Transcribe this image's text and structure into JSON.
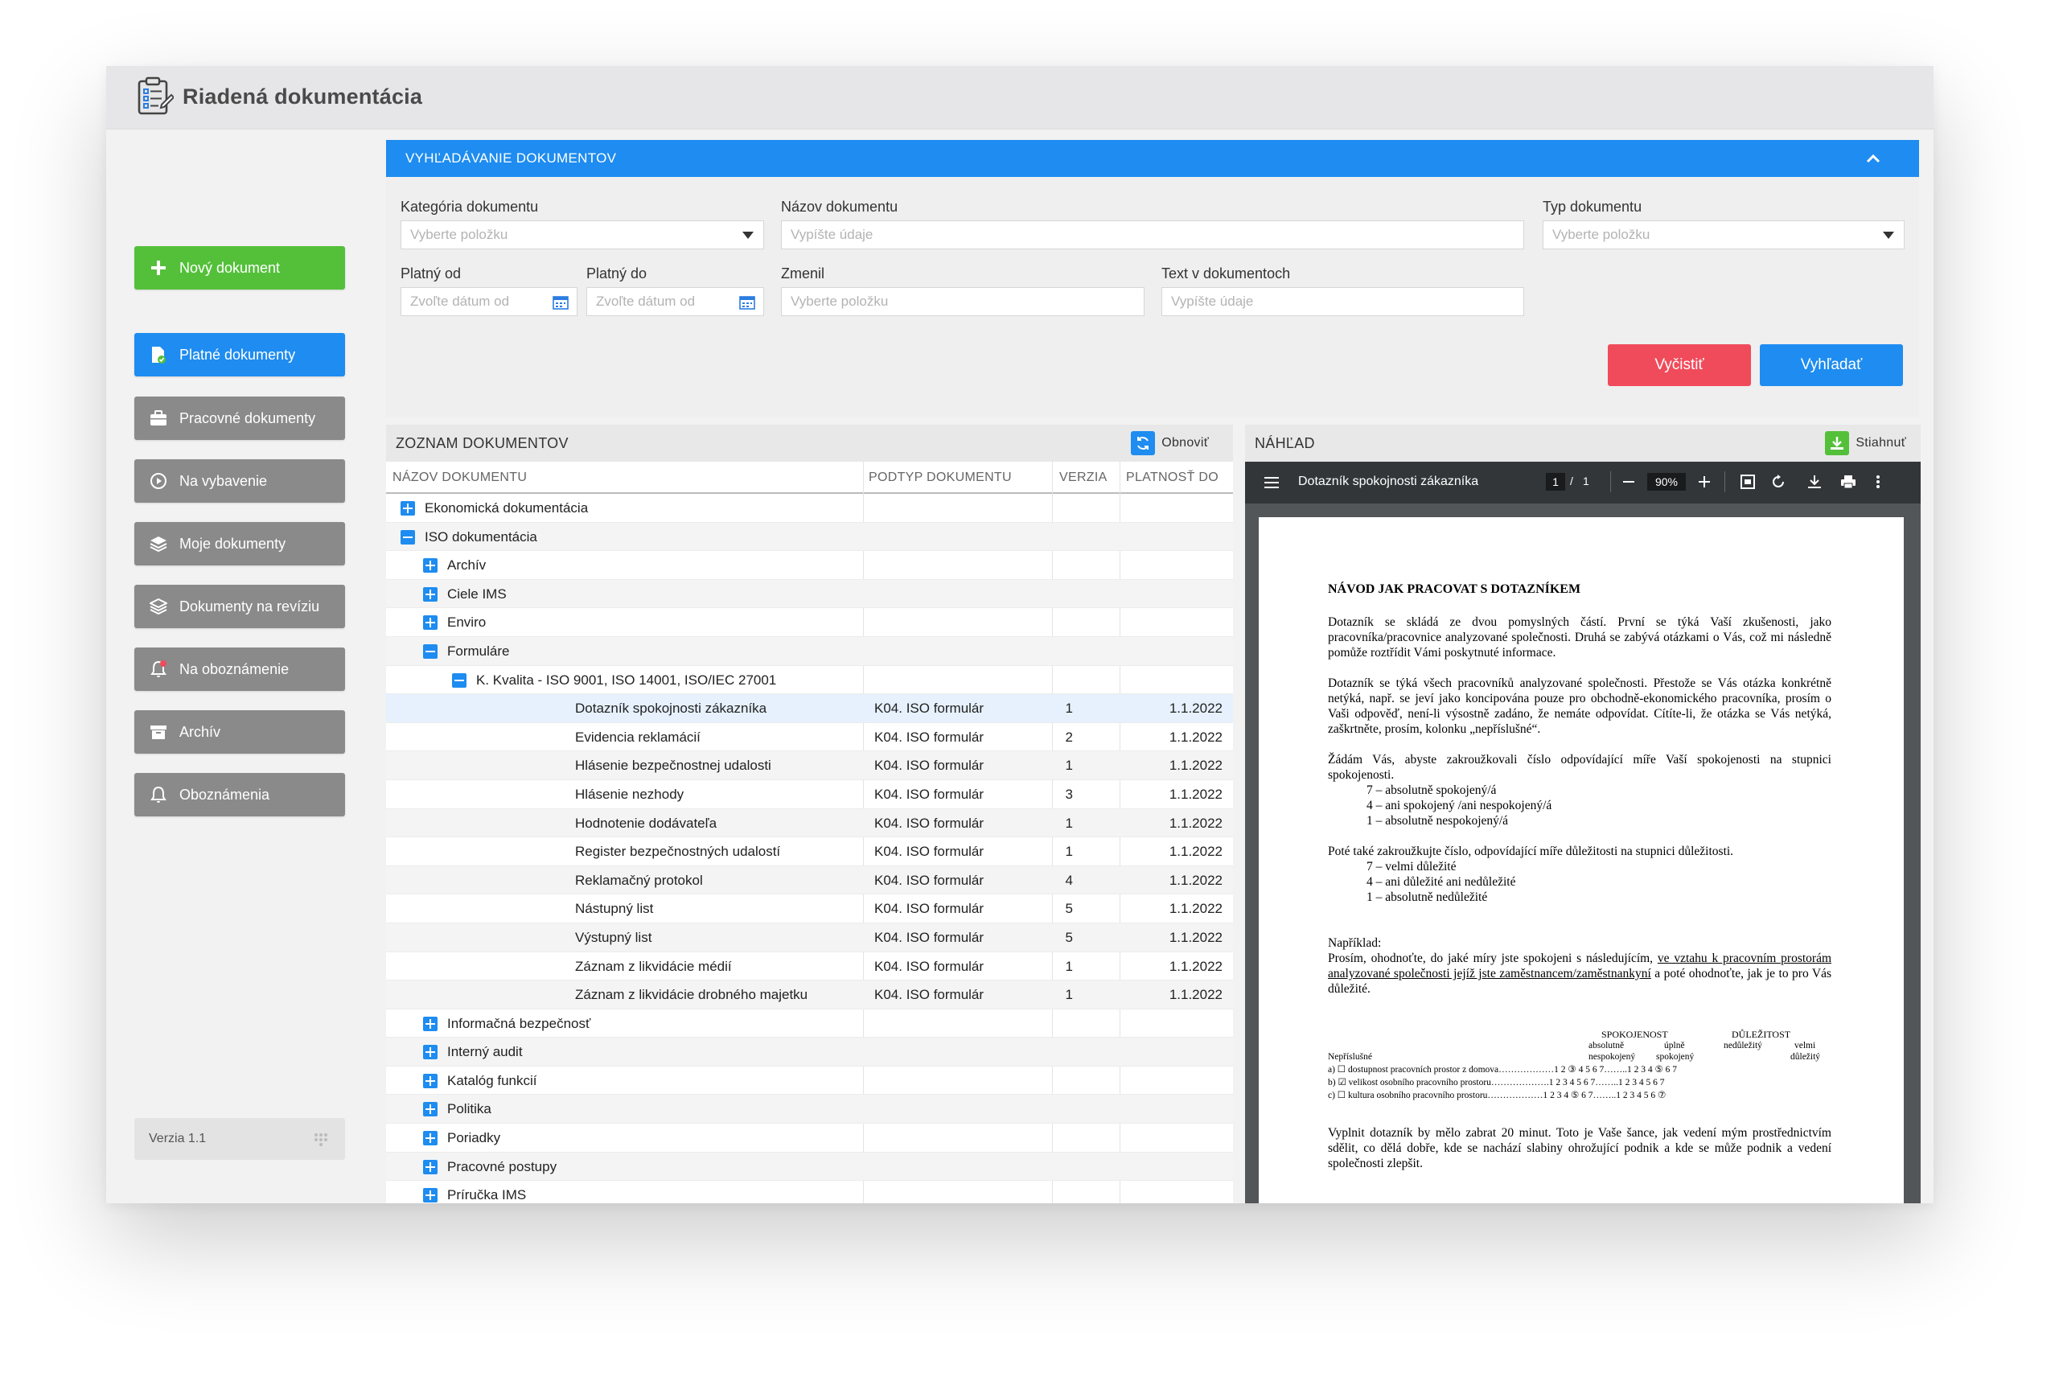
{
  "app": {
    "title": "Riadená dokumentácia"
  },
  "sidebar": {
    "new_document": "Nový dokument",
    "items": [
      {
        "label": "Platné dokumenty",
        "icon": "valid-docs-icon",
        "active": true
      },
      {
        "label": "Pracovné dokumenty",
        "icon": "briefcase-icon",
        "active": false
      },
      {
        "label": "Na vybavenie",
        "icon": "play-circle-icon",
        "active": false
      },
      {
        "label": "Moje dokumenty",
        "icon": "layers-icon",
        "active": false
      },
      {
        "label": "Dokumenty na revíziu",
        "icon": "layers-check-icon",
        "active": false
      },
      {
        "label": "Na oboznámenie",
        "icon": "bell-alert-icon",
        "active": false
      },
      {
        "label": "Archív",
        "icon": "archive-box-icon",
        "active": false
      },
      {
        "label": "Oboznámenia",
        "icon": "bell-icon",
        "active": false
      }
    ],
    "version": "Verzia 1.1"
  },
  "search": {
    "title": "VYHĽADÁVANIE DOKUMENTOV",
    "category": {
      "label": "Kategória dokumentu",
      "placeholder": "Vyberte položku"
    },
    "name": {
      "label": "Názov dokumentu",
      "placeholder": "Vypíšte údaje"
    },
    "type": {
      "label": "Typ dokumentu",
      "placeholder": "Vyberte položku"
    },
    "valid_from": {
      "label": "Platný od",
      "placeholder": "Zvoľte dátum od"
    },
    "valid_to": {
      "label": "Platný do",
      "placeholder": "Zvoľte dátum od"
    },
    "changed_by": {
      "label": "Zmenil",
      "placeholder": "Vyberte položku"
    },
    "fulltext": {
      "label": "Text v dokumentoch",
      "placeholder": "Vypíšte údaje"
    },
    "clear_button": "Vyčistiť",
    "search_button": "Vyhľadať"
  },
  "colors": {
    "accent_blue": "#1e8cf0",
    "green": "#54c03a",
    "red": "#f04b5b",
    "sidebar_gray": "#8a8a8a"
  },
  "list": {
    "title": "ZOZNAM DOKUMENTOV",
    "refresh": "Obnoviť",
    "columns": [
      "NÁZOV DOKUMENTU",
      "PODTYP DOKUMENTU",
      "VERZIA",
      "PLATNOSŤ DO"
    ],
    "rows": [
      {
        "level": 0,
        "toggle": "plus",
        "name": "Ekonomická dokumentácia"
      },
      {
        "level": 0,
        "toggle": "minus",
        "name": "ISO dokumentácia"
      },
      {
        "level": 1,
        "toggle": "plus",
        "name": "Archív"
      },
      {
        "level": 1,
        "toggle": "plus",
        "name": "Ciele IMS"
      },
      {
        "level": 1,
        "toggle": "plus",
        "name": "Enviro"
      },
      {
        "level": 1,
        "toggle": "minus",
        "name": "Formuláre"
      },
      {
        "level": 2,
        "toggle": "minus",
        "name": "K. Kvalita - ISO 9001, ISO 14001, ISO/IEC 27001"
      },
      {
        "level": 3,
        "name": "Dotazník spokojnosti zákazníka",
        "subtype": "K04. ISO formulár",
        "version": "1",
        "valid_to": "1.1.2022",
        "selected": true
      },
      {
        "level": 3,
        "name": "Evidencia reklamácií",
        "subtype": "K04. ISO formulár",
        "version": "2",
        "valid_to": "1.1.2022"
      },
      {
        "level": 3,
        "name": "Hlásenie bezpečnostnej udalosti",
        "subtype": "K04. ISO formulár",
        "version": "1",
        "valid_to": "1.1.2022"
      },
      {
        "level": 3,
        "name": "Hlásenie nezhody",
        "subtype": "K04. ISO formulár",
        "version": "3",
        "valid_to": "1.1.2022"
      },
      {
        "level": 3,
        "name": "Hodnotenie dodávateľa",
        "subtype": "K04. ISO formulár",
        "version": "1",
        "valid_to": "1.1.2022"
      },
      {
        "level": 3,
        "name": "Register bezpečnostných udalostí",
        "subtype": "K04. ISO formulár",
        "version": "1",
        "valid_to": "1.1.2022"
      },
      {
        "level": 3,
        "name": "Reklamačný protokol",
        "subtype": "K04. ISO formulár",
        "version": "4",
        "valid_to": "1.1.2022"
      },
      {
        "level": 3,
        "name": "Nástupný list",
        "subtype": "K04. ISO formulár",
        "version": "5",
        "valid_to": "1.1.2022"
      },
      {
        "level": 3,
        "name": "Výstupný list",
        "subtype": "K04. ISO formulár",
        "version": "5",
        "valid_to": "1.1.2022"
      },
      {
        "level": 3,
        "name": "Záznam z likvidácie médií",
        "subtype": "K04. ISO formulár",
        "version": "1",
        "valid_to": "1.1.2022"
      },
      {
        "level": 3,
        "name": "Záznam z likvidácie drobného majetku",
        "subtype": "K04. ISO formulár",
        "version": "1",
        "valid_to": "1.1.2022"
      },
      {
        "level": 1,
        "toggle": "plus",
        "name": "Informačná bezpečnosť"
      },
      {
        "level": 1,
        "toggle": "plus",
        "name": "Interný audit"
      },
      {
        "level": 1,
        "toggle": "plus",
        "name": "Katalóg funkcií"
      },
      {
        "level": 1,
        "toggle": "plus",
        "name": "Politika"
      },
      {
        "level": 1,
        "toggle": "plus",
        "name": "Poriadky"
      },
      {
        "level": 1,
        "toggle": "plus",
        "name": "Pracovné postupy"
      },
      {
        "level": 1,
        "toggle": "plus",
        "name": "Príručka IMS"
      }
    ]
  },
  "preview": {
    "title": "NÁHĽAD",
    "download": "Stiahnuť",
    "pdf_title": "Dotazník spokojnosti zákazníka",
    "page_current": "1",
    "page_sep": "/",
    "page_total": "1",
    "zoom": "90%",
    "doc": {
      "heading": "NÁVOD JAK PRACOVAT S DOTAZNÍKEM",
      "p1": "Dotazník se skládá ze dvou pomyslných částí. První se týká Vaší zkušenosti, jako pracovníka/pracovnice analyzované společnosti. Druhá se zabývá otázkami o Vás, což mi následně pomůže roztřídit Vámi poskytnuté informace.",
      "p2": "Dotazník se týká všech pracovníků analyzované společnosti. Přestože se Vás otázka konkrétně netýká, např. se jeví jako koncipována pouze pro obchodně-ekonomického pracovníka, prosím o Vaši odpověď, není-li výsostně zadáno, že nemáte odpovídat. Cítíte-li, že otázka se Vás netýká, zaškrtněte, prosím, kolonku „nepříslušné“.",
      "p3": "Žádám Vás, abyste zakroužkovali číslo odpovídající míře Vaší spokojenosti na stupnici spokojenosti.",
      "p3_items": [
        "7 – absolutně spokojený/á",
        "4 – ani spokojený /ani nespokojený/á",
        "1 – absolutně nespokojený/á"
      ],
      "p4": "Poté také zakroužkujte číslo, odpovídající míře důležitosti na stupnici důležitosti.",
      "p4_items": [
        "7 – velmi důležité",
        "4 – ani důležité ani nedůležité",
        "1 – absolutně nedůležité"
      ],
      "example_label": "Například:",
      "example_pre": "Prosím, ohodnoťte, do jaké míry jste spokojeni s následujícím,",
      "example_link": "ve vztahu k pracovním prostorám analyzované společnosti jejíž jste zaměstnancem/zaměstnankyní",
      "example_post": "a poté ohodnoťte, jak je to pro Vás důležité.",
      "table": {
        "h_satisfaction": "SPOKOJENOST",
        "h_importance": "DŮLEŽITOST",
        "sub_abs": "absolutně",
        "sub_abs2": "nespokojený",
        "sub_full": "úplně",
        "sub_full2": "spokojený",
        "sub_unimp": "nedůležitý",
        "sub_very": "velmi",
        "sub_very2": "důležitý",
        "na": "Nepříslušné",
        "rows": [
          {
            "prefix": "a) ☐",
            "label": "dostupnost pracovních prostor z domova………………1",
            "sat": "2 ③ 4  5  6  7……..1",
            "imp": "2  3  4 ⑤ 6  7"
          },
          {
            "prefix": "b) ☑",
            "label": "velikost osobního pracovního prostoru……………….1",
            "sat": "2  3  4  5  6  7……..1",
            "imp": "2  3  4  5  6  7"
          },
          {
            "prefix": "c) ☐",
            "label": "kultura osobního pracovního prostoru………………1",
            "sat": "2  3  4 ⑤ 6  7……..1",
            "imp": "2  3  4  5  6 ⑦"
          }
        ]
      },
      "p5": "Vyplnit dotazník by mělo zabrat 20 minut. Toto je Vaše šance, jak vedení mým prostřednictvím sdělit, co dělá dobře, kde se nachází slabiny ohrožující podnik a kde se může podnik a vedení společnosti zlepšit."
    }
  }
}
